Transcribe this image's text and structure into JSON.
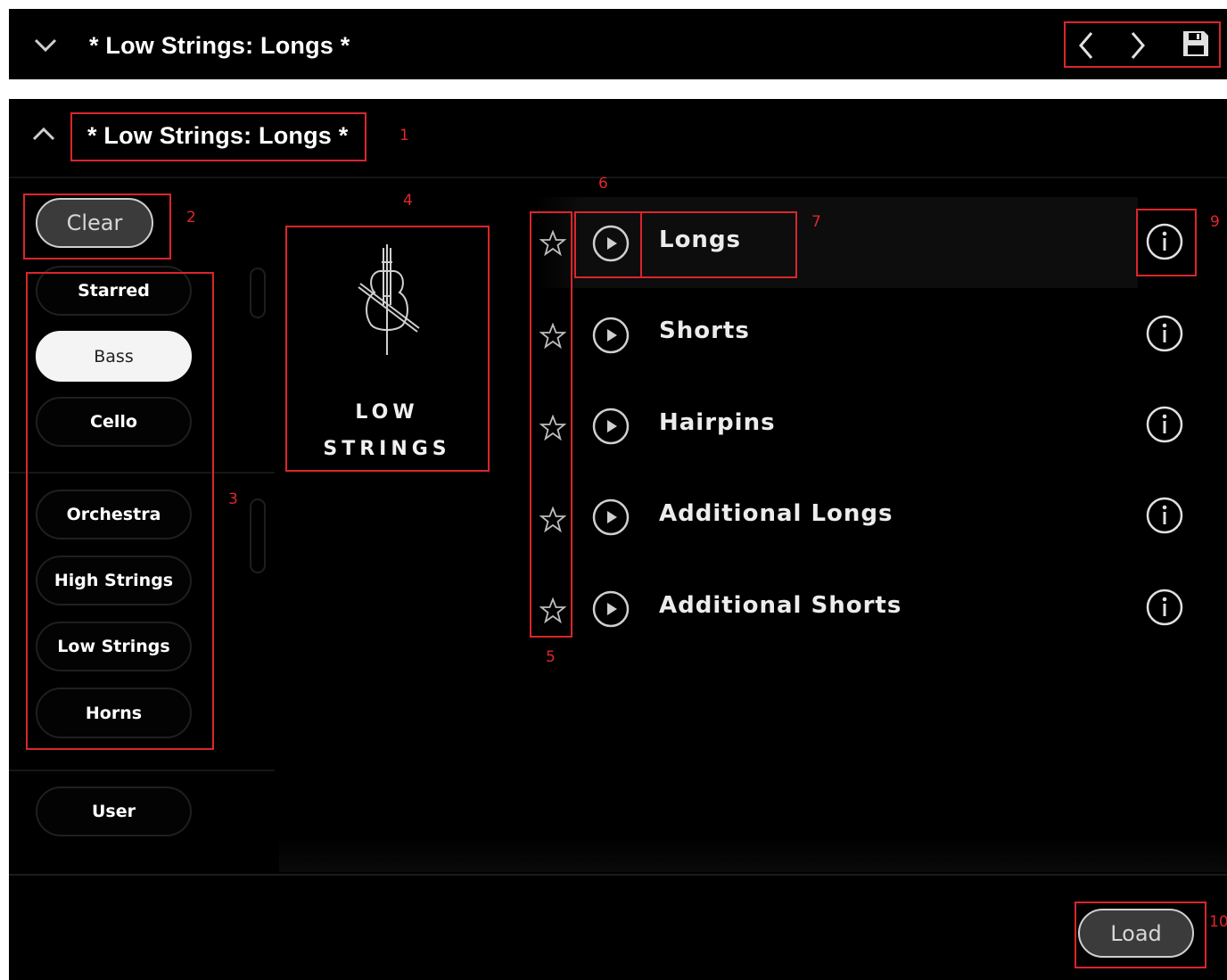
{
  "topbar": {
    "title": "* Low Strings: Longs *",
    "icons": [
      "chevron-down-icon",
      "chevron-left-icon",
      "chevron-right-icon",
      "save-icon"
    ]
  },
  "panel": {
    "title": "* Low Strings: Longs *",
    "collapse_icon": "chevron-up-icon"
  },
  "sidebar": {
    "clear_label": "Clear",
    "filters": [
      {
        "label": "Starred",
        "active": false
      },
      {
        "label": "Bass",
        "active": true
      },
      {
        "label": "Cello",
        "active": false
      },
      {
        "label": "Orchestra",
        "active": false
      },
      {
        "label": "High Strings",
        "active": false
      },
      {
        "label": "Low Strings",
        "active": false
      },
      {
        "label": "Horns",
        "active": false
      }
    ],
    "user_label": "User"
  },
  "instrument": {
    "icon": "cello-icon",
    "name_line1": "LOW",
    "name_line2": "STRINGS"
  },
  "presets": [
    {
      "name": "Longs",
      "selected": true
    },
    {
      "name": "Shorts",
      "selected": false
    },
    {
      "name": "Hairpins",
      "selected": false
    },
    {
      "name": "Additional Longs",
      "selected": false
    },
    {
      "name": "Additional Shorts",
      "selected": false
    }
  ],
  "footer": {
    "load_label": "Load"
  },
  "annotations": {
    "a1": "1",
    "a2": "2",
    "a3": "3",
    "a4": "4",
    "a5": "5",
    "a6": "6",
    "a7": "7",
    "a9": "9",
    "a10": "10"
  },
  "colors": {
    "background": "#000000",
    "annotation_red": "#d9262b",
    "active_pill": "#f4f4f4"
  }
}
